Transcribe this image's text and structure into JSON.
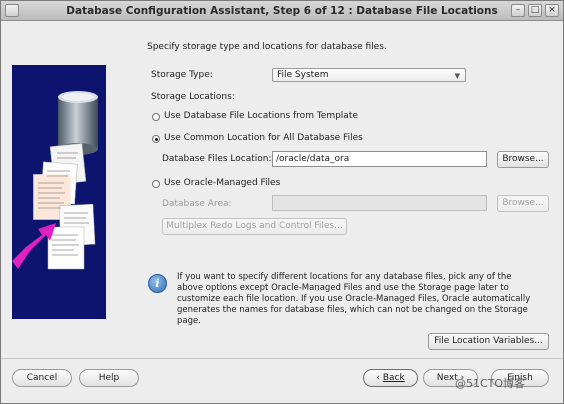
{
  "window": {
    "title": "Database Configuration Assistant, Step 6 of 12 : Database File Locations"
  },
  "main": {
    "intro": "Specify storage type and locations for database files.",
    "storage_type_label": "Storage Type:",
    "storage_type_value": "File System",
    "storage_locations_label": "Storage Locations:",
    "option_template": "Use Database File Locations from Template",
    "option_common": "Use Common Location for All Database Files",
    "db_files_location_label": "Database Files Location:",
    "db_files_location_value": "/oracle/data_ora",
    "browse_label": "Browse...",
    "option_omf": "Use Oracle-Managed Files",
    "db_area_label": "Database Area:",
    "db_area_value": "",
    "browse_disabled_label": "Browse...",
    "multiplex_label": "Multiplex Redo Logs and Control Files...",
    "info_text": "If you want to specify different locations for any database files, pick any of the above options except Oracle-Managed Files and use the Storage page later to customize each file location. If you use Oracle-Managed Files, Oracle automatically generates the names for database files, which can not be changed on the Storage page.",
    "file_location_variables_label": "File Location Variables...",
    "selected_option": "common"
  },
  "footer": {
    "cancel_label": "Cancel",
    "help_label": "Help",
    "back_label": "Back",
    "next_label": "Next",
    "finish_label": "Finish"
  },
  "watermark": {
    "text": "@51CTO博客"
  },
  "icons": {
    "info": "info-icon",
    "dropdown": "chevron-down-icon",
    "back": "chevron-left-icon",
    "next": "chevron-right-icon",
    "illustration": "database-files-illustration"
  },
  "colors": {
    "sidebar_bg": "#0d1470",
    "accent_magenta": "#e020c0",
    "info_blue": "#2f6fb4"
  }
}
